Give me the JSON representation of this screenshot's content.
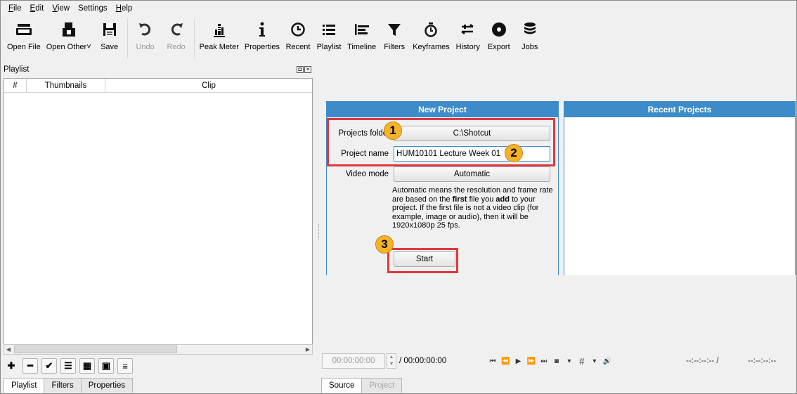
{
  "menu": [
    {
      "underline": "F",
      "rest": "ile"
    },
    {
      "underline": "E",
      "rest": "dit"
    },
    {
      "underline": "V",
      "rest": "iew"
    },
    {
      "underline": "",
      "rest": "Settings"
    },
    {
      "underline": "H",
      "rest": "elp"
    }
  ],
  "toolbar": {
    "open_file": "Open File",
    "open_other": "Open Other",
    "save": "Save",
    "undo": "Undo",
    "redo": "Redo",
    "peak_meter": "Peak Meter",
    "properties": "Properties",
    "recent": "Recent",
    "playlist": "Playlist",
    "timeline": "Timeline",
    "filters": "Filters",
    "keyframes": "Keyframes",
    "history": "History",
    "export": "Export",
    "jobs": "Jobs"
  },
  "playlist": {
    "title": "Playlist",
    "col_num": "#",
    "col_thumbnails": "Thumbnails",
    "col_clip": "Clip"
  },
  "new_project": {
    "header": "New Project",
    "folder_label": "Projects folder",
    "folder_value": "C:\\Shotcut",
    "name_label": "Project name",
    "name_value": "HUM10101 Lecture Week 01",
    "video_mode_label": "Video mode",
    "video_mode_value": "Automatic",
    "desc_a": "Automatic means the resolution and frame rate are based on the ",
    "desc_first": "first",
    "desc_b": " file you ",
    "desc_add": "add",
    "desc_c": " to your project. If the first file is not a video clip (for example, image or audio), then it will be 1920x1080p 25 fps.",
    "start": "Start"
  },
  "recent_projects": {
    "header": "Recent Projects"
  },
  "badges": {
    "one": "1",
    "two": "2",
    "three": "3"
  },
  "transport": {
    "position": "00:00:00:00",
    "duration": "/ 00:00:00:00",
    "in_out": "--:--:--:-- /",
    "out": "--:--:--:--"
  },
  "left_tabs": [
    "Playlist",
    "Filters",
    "Properties"
  ],
  "right_tabs": [
    "Source",
    "Project"
  ],
  "colors": {
    "accent": "#3d8cc9",
    "highlight": "#e0383e",
    "badge": "#f6b32a"
  }
}
